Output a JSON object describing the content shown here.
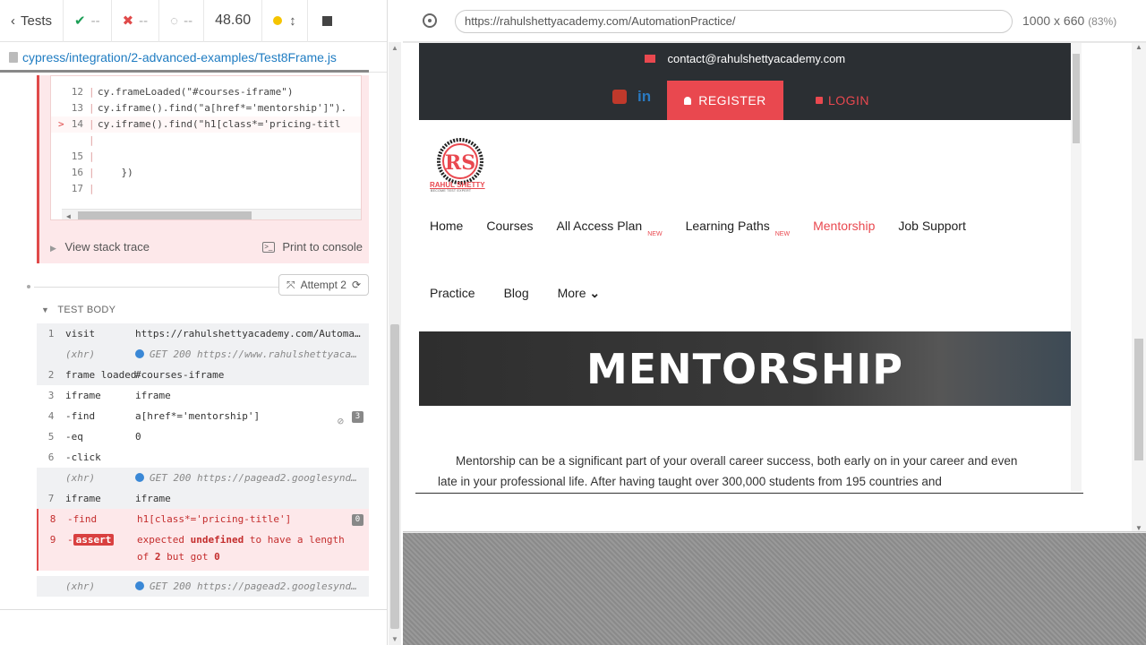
{
  "reporter": {
    "back_label": "Tests",
    "passed": "--",
    "failed": "--",
    "pending": "--",
    "duration": "48.60",
    "spec_path": "cypress/integration/2-advanced-examples/Test8Frame.js"
  },
  "code_frame": {
    "lines": [
      {
        "num": "12",
        "code": "cy.frameLoaded(\"#courses-iframe\")",
        "marker": ""
      },
      {
        "num": "13",
        "code": "cy.iframe().find(\"a[href*='mentorship']\").",
        "marker": ""
      },
      {
        "num": "14",
        "code": "cy.iframe().find(\"h1[class*='pricing-titl",
        "marker": ">"
      },
      {
        "num": "",
        "code": "",
        "marker": ""
      },
      {
        "num": "15",
        "code": "",
        "marker": ""
      },
      {
        "num": "16",
        "code": "    })",
        "marker": ""
      },
      {
        "num": "17",
        "code": "",
        "marker": ""
      }
    ],
    "view_stack_trace": "View stack trace",
    "print_to_console": "Print to console"
  },
  "attempt_label": "Attempt 2",
  "test_body_label": "TEST BODY",
  "commands": [
    {
      "num": "1",
      "name": "visit",
      "msg": "https://rahulshettyacademy.com/Automa…",
      "kind": "grey"
    },
    {
      "num": "",
      "name": "(xhr)",
      "msg": "GET 200 https://www.rahulshettyaca…",
      "kind": "xhr"
    },
    {
      "num": "2",
      "name": "frame loaded",
      "msg": "#courses-iframe",
      "kind": "grey"
    },
    {
      "num": "3",
      "name": "iframe",
      "msg": "iframe",
      "kind": "plain"
    },
    {
      "num": "4",
      "name": " -find",
      "msg": "a[href*='mentorship']",
      "kind": "plain",
      "count": "3"
    },
    {
      "num": "5",
      "name": " -eq",
      "msg": "0",
      "kind": "plain"
    },
    {
      "num": "6",
      "name": " -click",
      "msg": "",
      "kind": "plain"
    },
    {
      "num": "",
      "name": "(xhr)",
      "msg": "GET 200 https://pagead2.googlesynd…",
      "kind": "xhr"
    },
    {
      "num": "7",
      "name": "iframe",
      "msg": "iframe",
      "kind": "grey"
    },
    {
      "num": "8",
      "name": " -find",
      "msg": "h1[class*='pricing-title']",
      "kind": "fail",
      "count": "0"
    }
  ],
  "assert_cmd": {
    "num": "9",
    "badge": "assert",
    "msg_parts": [
      "expected",
      "undefined",
      "to have a length",
      "of",
      "2",
      "but got",
      "0"
    ]
  },
  "last_xhr": {
    "name": "(xhr)",
    "msg": "GET 200 https://pagead2.googlesynd…"
  },
  "aut": {
    "url": "https://rahulshettyacademy.com/AutomationPractice/",
    "viewport": "1000 x 660",
    "scale": "(83%)"
  },
  "site": {
    "contact_email": "contact@rahulshettyacademy.com",
    "register": "REGISTER",
    "login": "LOGIN",
    "logo_text": "RAHUL SHETTY",
    "logo_tagline": "BECOME TEST EXPERT",
    "nav_row1": [
      "Home",
      "Courses",
      "All Access Plan",
      "Learning Paths",
      "Mentorship",
      "Job Support"
    ],
    "new_badge": "NEW",
    "nav_row2": [
      "Practice",
      "Blog",
      "More"
    ],
    "hero_title": "MENTORSHIP",
    "paragraph": "Mentorship can be a significant part of your overall career success, both early on in your career and even late in your professional life. After having taught over 300,000 students from 195 countries and"
  },
  "colors": {
    "accent": "#e9484f",
    "fail": "#e04a4a",
    "pass": "#1b9e55",
    "link": "#1f7cc2",
    "dark_header": "#2b2f33"
  }
}
